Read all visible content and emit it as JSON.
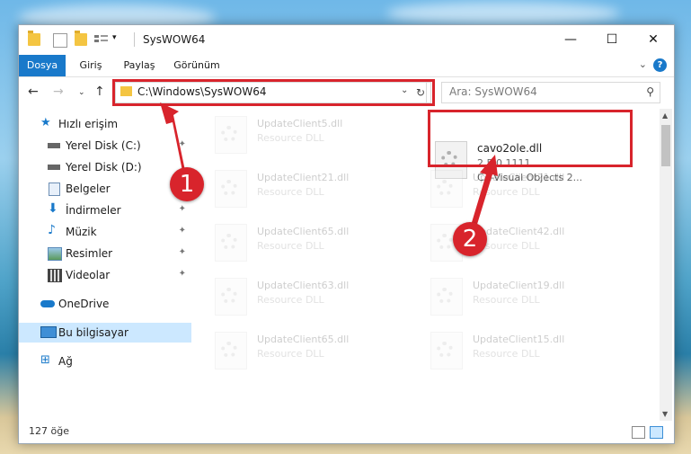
{
  "window": {
    "title": "SysWOW64"
  },
  "ribbon": {
    "tabs": [
      {
        "label": "Dosya",
        "active": true
      },
      {
        "label": "Giriş",
        "active": false
      },
      {
        "label": "Paylaş",
        "active": false
      },
      {
        "label": "Görünüm",
        "active": false
      }
    ],
    "help": "?"
  },
  "nav": {
    "address": "C:\\Windows\\SysWOW64",
    "search_placeholder": "Ara: SysWOW64"
  },
  "sidebar": {
    "items": [
      {
        "label": "Hızlı erişim",
        "icon": "star-icon",
        "pinned": false
      },
      {
        "label": "Yerel Disk (C:)",
        "icon": "drive-icon",
        "pinned": true
      },
      {
        "label": "Yerel Disk (D:)",
        "icon": "drive-icon",
        "pinned": false
      },
      {
        "label": "Belgeler",
        "icon": "document-icon",
        "pinned": false
      },
      {
        "label": "İndirmeler",
        "icon": "download-icon",
        "pinned": true
      },
      {
        "label": "Müzik",
        "icon": "music-icon",
        "pinned": true
      },
      {
        "label": "Resimler",
        "icon": "pictures-icon",
        "pinned": true
      },
      {
        "label": "Videolar",
        "icon": "video-icon",
        "pinned": true
      },
      {
        "label": "OneDrive",
        "icon": "cloud-icon",
        "pinned": false
      },
      {
        "label": "Bu bilgisayar",
        "icon": "computer-icon",
        "pinned": false
      },
      {
        "label": "Ağ",
        "icon": "network-icon",
        "pinned": false
      }
    ]
  },
  "files": {
    "left_column": [
      {
        "name": "UpdateClient5.dll",
        "type": "Resource DLL"
      },
      {
        "name": "UpdateClient21.dll",
        "type": "Resource DLL"
      },
      {
        "name": "UpdateClient65.dll",
        "type": "Resource DLL"
      },
      {
        "name": "UpdateClient63.dll",
        "type": "Resource DLL"
      },
      {
        "name": "UpdateClient65.dll",
        "type": "Resource DLL"
      }
    ],
    "right_column": [
      {
        "name": "UpdateClient21.dll",
        "type": "Resource DLL"
      },
      {
        "name": "UpdateClient42.dll",
        "type": "Resource DLL"
      },
      {
        "name": "UpdateClient19.dll",
        "type": "Resource DLL"
      },
      {
        "name": "UpdateClient15.dll",
        "type": "Resource DLL"
      }
    ],
    "selected": {
      "name": "cavo2ole.dll",
      "version": "2.5.0.1111",
      "company": "CA-Visual Objects 2..."
    }
  },
  "status": {
    "count": "127 öğe"
  },
  "annotations": {
    "step1": "1",
    "step2": "2",
    "color": "#d8242c"
  }
}
